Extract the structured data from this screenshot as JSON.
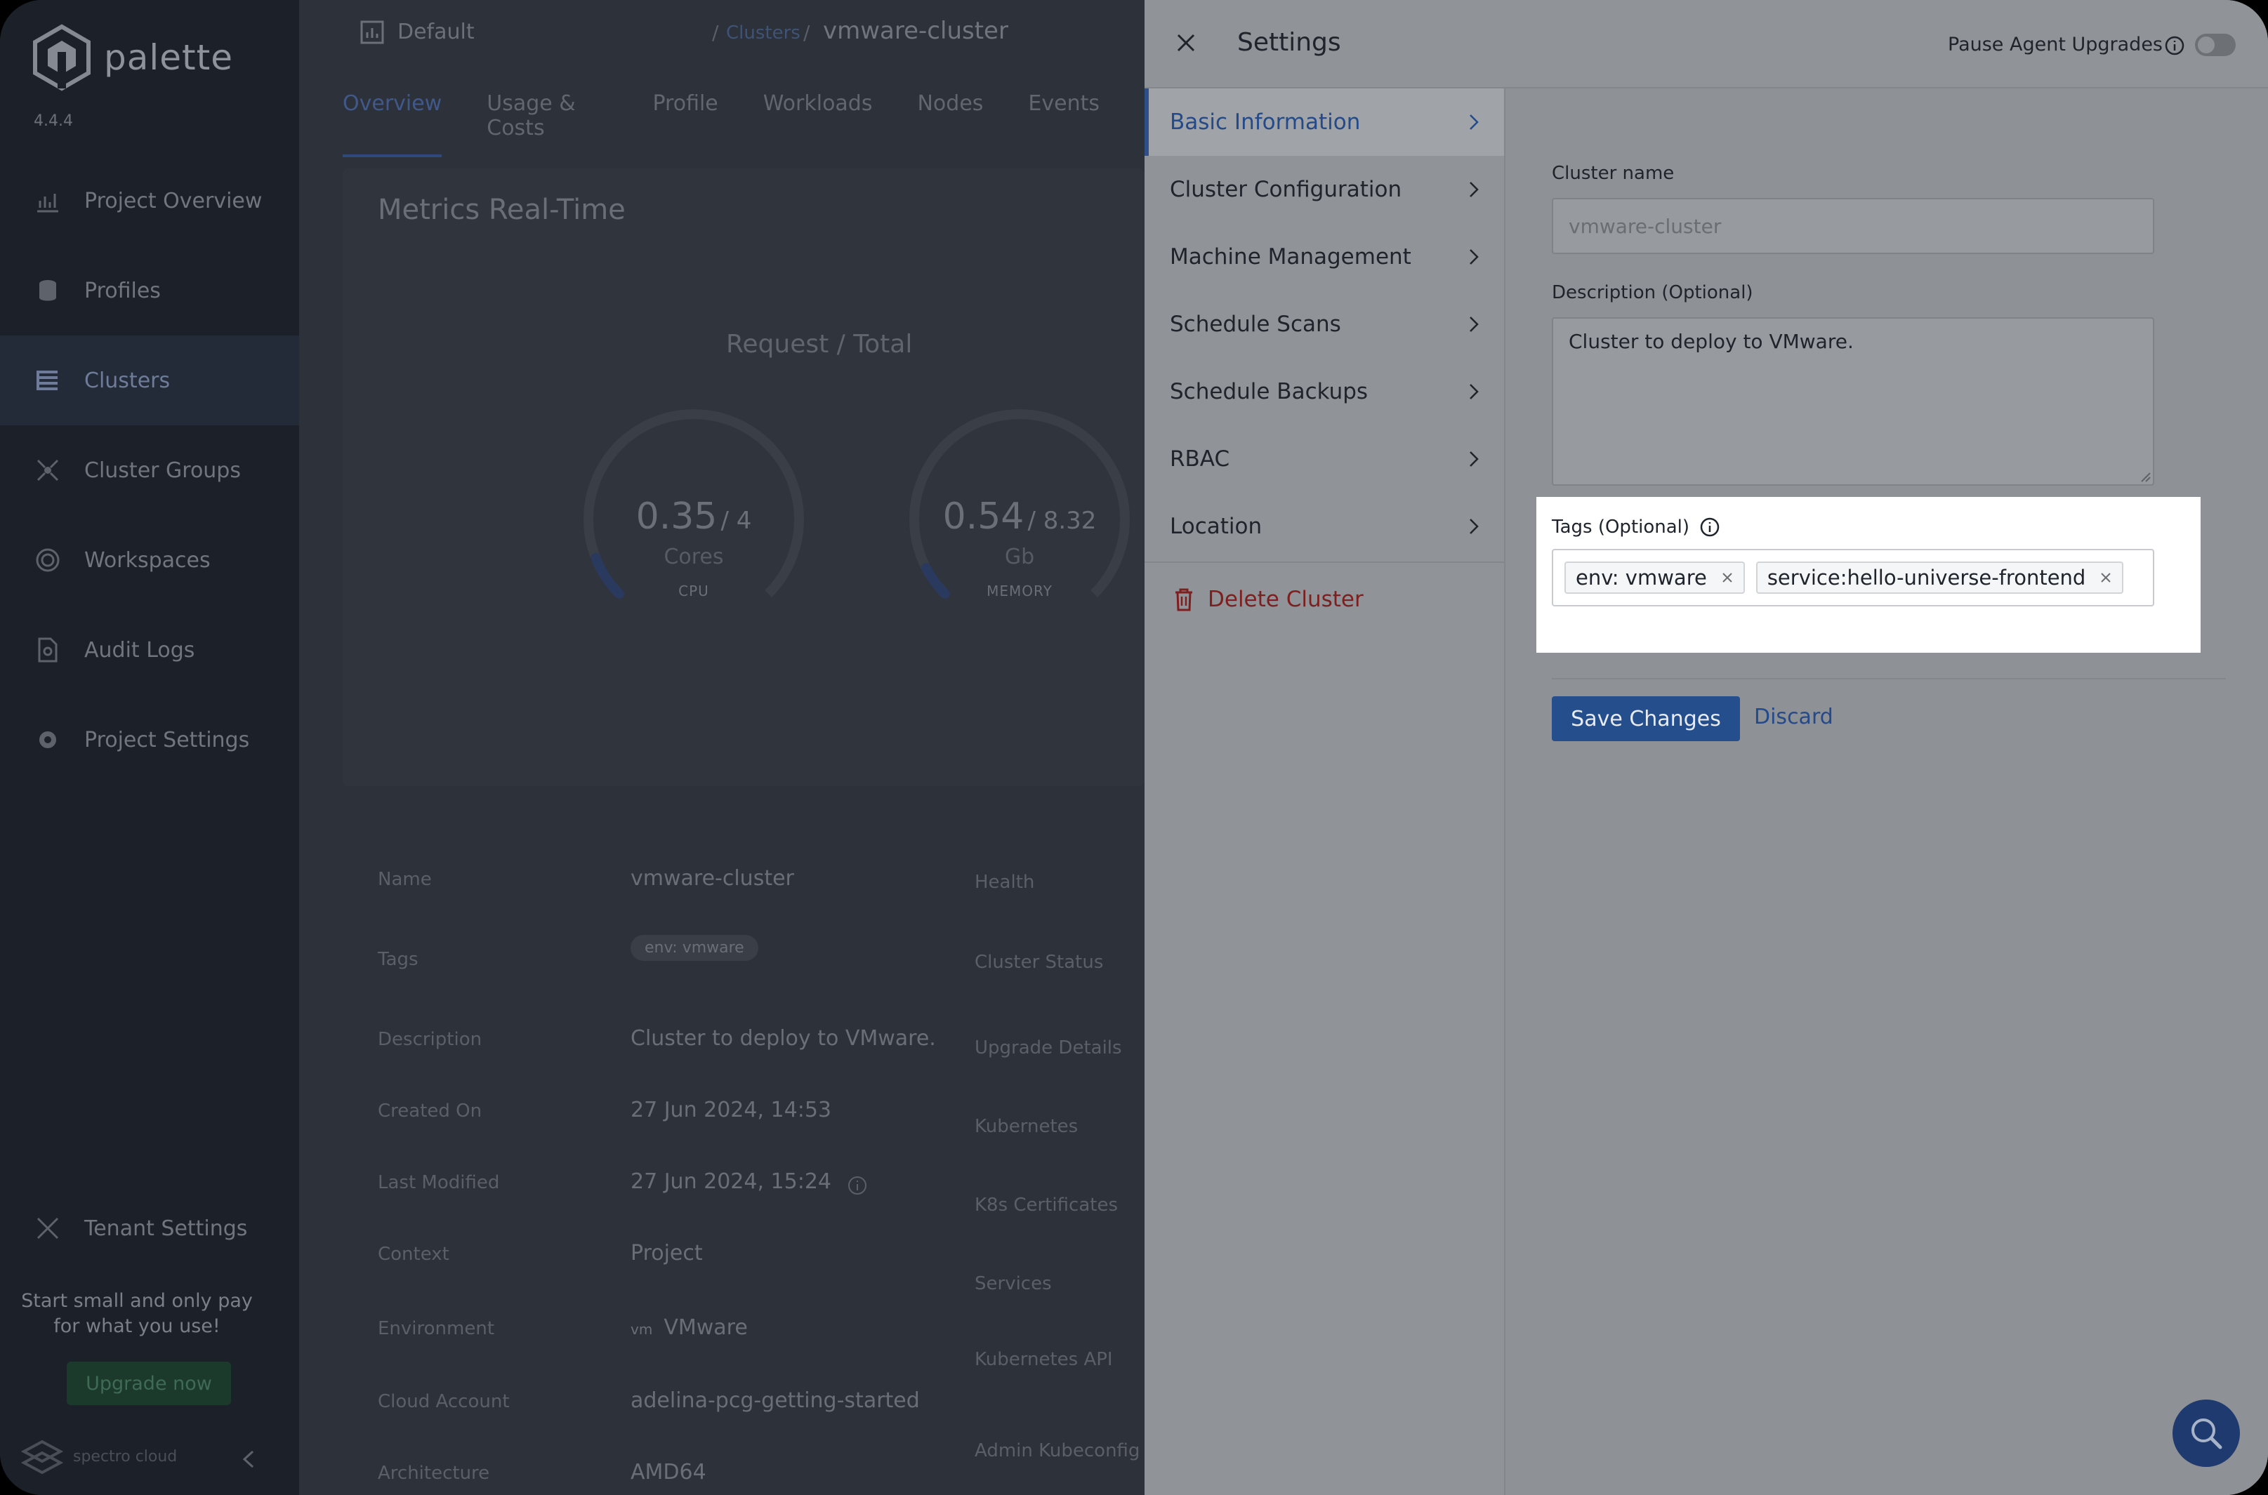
{
  "sidebar": {
    "brand": "palette",
    "version": "4.4.4",
    "items": [
      {
        "label": "Project Overview",
        "icon": "chart-icon"
      },
      {
        "label": "Profiles",
        "icon": "stack-icon"
      },
      {
        "label": "Clusters",
        "icon": "list-icon"
      },
      {
        "label": "Cluster Groups",
        "icon": "network-icon"
      },
      {
        "label": "Workspaces",
        "icon": "target-icon"
      },
      {
        "label": "Audit Logs",
        "icon": "document-icon"
      },
      {
        "label": "Project Settings",
        "icon": "gear-icon"
      }
    ],
    "tenant_settings": "Tenant Settings",
    "promo_line1": "Start small and only pay",
    "promo_line2": "for what you use!",
    "upgrade_label": "Upgrade now",
    "footer_brand": "spectro cloud"
  },
  "main": {
    "project": "Default",
    "breadcrumb_link": "Clusters",
    "breadcrumb_current": "vmware-cluster",
    "tabs": [
      "Overview",
      "Usage & Costs",
      "Profile",
      "Workloads",
      "Nodes",
      "Events"
    ],
    "metrics_title": "Metrics Real-Time",
    "request_total": "Request / Total",
    "gauges": [
      {
        "value": "0.35",
        "total": "/ 4",
        "unit": "Cores",
        "name": "CPU",
        "fraction": 0.0875
      },
      {
        "value": "0.54",
        "total": "/ 8.32",
        "unit": "Gb",
        "name": "MEMORY",
        "fraction": 0.065
      }
    ],
    "details": [
      {
        "key": "Name",
        "value": "vmware-cluster"
      },
      {
        "key": "Tags",
        "value": "env: vmware"
      },
      {
        "key": "Description",
        "value": "Cluster to deploy to VMware."
      },
      {
        "key": "Created On",
        "value": "27 Jun 2024, 14:53"
      },
      {
        "key": "Last Modified",
        "value": "27 Jun 2024, 15:24"
      },
      {
        "key": "Context",
        "value": "Project"
      },
      {
        "key": "Environment",
        "value": "VMware"
      },
      {
        "key": "Cloud Account",
        "value": "adelina-pcg-getting-started"
      },
      {
        "key": "Architecture",
        "value": "AMD64"
      }
    ],
    "right_keys": [
      "Health",
      "Cluster Status",
      "Upgrade Details",
      "Kubernetes",
      "K8s Certificates",
      "Services",
      "Kubernetes API",
      "Admin Kubeconfig F"
    ],
    "env_logo": "vm"
  },
  "settings": {
    "title": "Settings",
    "pause_label": "Pause Agent Upgrades",
    "menu": [
      {
        "label": "Basic Information",
        "active": true
      },
      {
        "label": "Cluster Configuration",
        "active": false
      },
      {
        "label": "Machine Management",
        "active": false
      },
      {
        "label": "Schedule Scans",
        "active": false
      },
      {
        "label": "Schedule Backups",
        "active": false
      },
      {
        "label": "RBAC",
        "active": false
      },
      {
        "label": "Location",
        "active": false
      }
    ],
    "delete_label": "Delete Cluster",
    "cluster_name_label": "Cluster name",
    "cluster_name_placeholder": "vmware-cluster",
    "description_label": "Description (Optional)",
    "description_value": "Cluster to deploy to VMware.",
    "tags_label": "Tags (Optional)",
    "tags": [
      "env: vmware",
      "service:hello-universe-frontend"
    ],
    "save_label": "Save Changes",
    "discard_label": "Discard"
  },
  "colors": {
    "accent": "#244e8c",
    "danger": "#7e1f1f",
    "drawer_bg": "#8e9196"
  }
}
